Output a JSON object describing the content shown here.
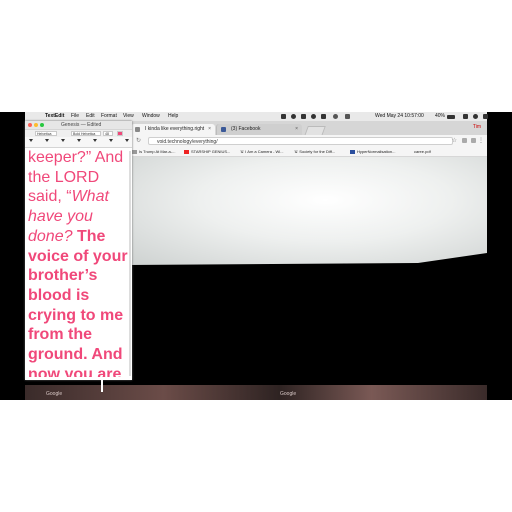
{
  "menubar": {
    "app": "TextEdit",
    "items": [
      "File",
      "Edit",
      "Format",
      "View",
      "Window",
      "Help"
    ],
    "clock": "Wed May 24  10:57:00",
    "battery": "40%"
  },
  "textedit": {
    "title": "Genesis — Edited",
    "toolbar": {
      "style": "Helvetica",
      "font": "Bold Helvetica",
      "size": "48"
    },
    "text_parts": [
      {
        "style": "normal",
        "text": "keeper?” And the LORD said, “"
      },
      {
        "style": "italic",
        "text": "What have you done? "
      },
      {
        "style": "bold",
        "text": "The voice of your brother’s blood is crying to me from the ground. And now you are"
      }
    ],
    "text_color": "#f0487a"
  },
  "browser": {
    "tabs": [
      {
        "label": "I kinda like everything.right"
      },
      {
        "label": "(3) Facebook"
      }
    ],
    "user": "Tim",
    "url": "void.technology/everything/",
    "bookmarks": [
      "Is Trump At Mar-a-...",
      "STARSHIP GENIUS...",
      "'&' I Am a Camera - Wi...",
      "'&' Society for the Diff...",
      "HyperNormalisation...",
      "caree.pdf"
    ]
  },
  "desktop": {
    "labels": [
      "Google",
      "Google"
    ]
  }
}
